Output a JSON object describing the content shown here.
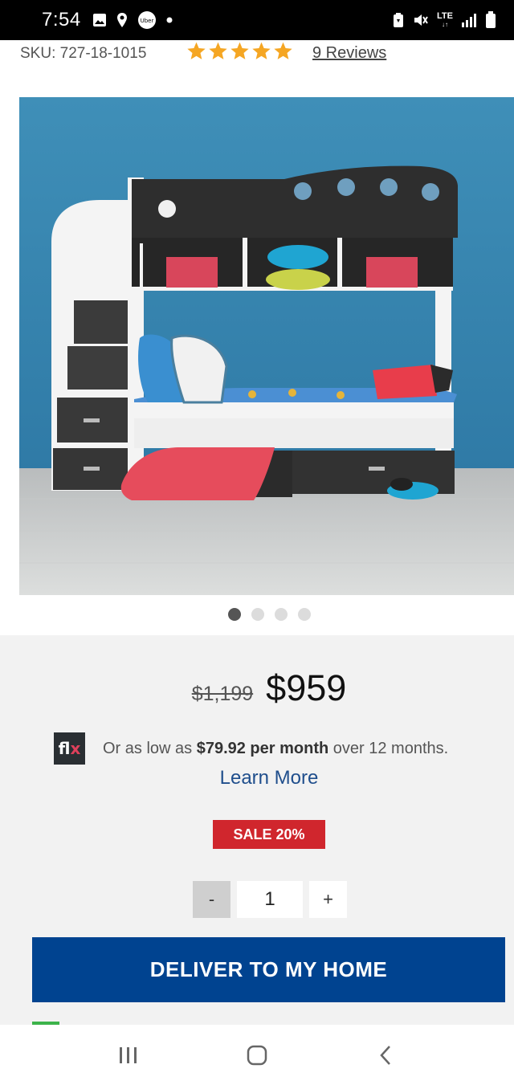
{
  "status_bar": {
    "time": "7:54",
    "left_icons": [
      "image-icon",
      "location-icon",
      "uber-icon",
      "dot-icon"
    ],
    "uber_label": "Uber",
    "network": "LTE",
    "right_icons": [
      "battery-saver-icon",
      "mute-icon",
      "lte-icon",
      "signal-icon",
      "battery-icon"
    ]
  },
  "product": {
    "sku": "SKU: 727-18-1015",
    "rating": 5,
    "reviews": "9 Reviews",
    "carousel": {
      "count": 4,
      "active_index": 0
    }
  },
  "pricing": {
    "old_price": "$1,199",
    "price": "$959",
    "financing_prefix": "Or as low as ",
    "financing_amount": "$79.92 per month",
    "financing_suffix": " over 12 months.",
    "learn_more": "Learn More",
    "sale_badge": "SALE 20%",
    "flx_logo_a": "fl",
    "flx_logo_b": "x"
  },
  "quantity": {
    "minus": "-",
    "value": "1",
    "plus": "+"
  },
  "actions": {
    "deliver": "DELIVER TO MY HOME"
  },
  "colors": {
    "deliver_button": "#004390",
    "sale_badge": "#d0262d",
    "star": "#f5a623",
    "link": "#1f4e8c"
  },
  "nav_bar": {
    "buttons": [
      "recent-apps-icon",
      "home-icon",
      "back-icon"
    ]
  }
}
